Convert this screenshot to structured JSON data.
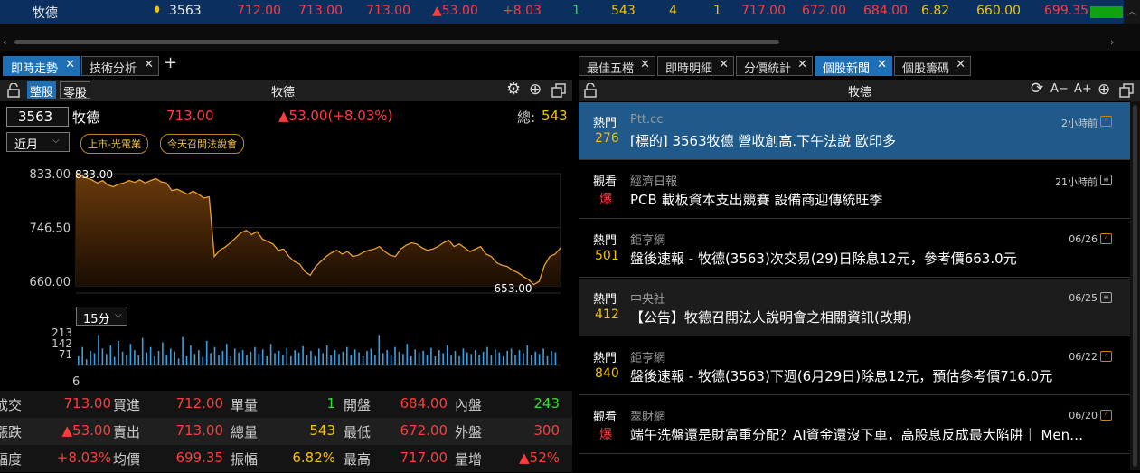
{
  "top_row": {
    "name": "牧德",
    "code": "3563",
    "v1": "712.00",
    "v2": "713.00",
    "v3": "713.00",
    "change": "▲53.00",
    "pct": "+8.03",
    "n1": "1",
    "n2": "543",
    "n3": "4",
    "n4": "1",
    "high": "717.00",
    "low": "672.00",
    "open": "684.00",
    "amp": "6.82",
    "avg": "660.00",
    "prev": "699.35"
  },
  "left_tabs": [
    {
      "label": "即時走勢"
    },
    {
      "label": "技術分析"
    }
  ],
  "add_tab": "+",
  "close_x": "✕",
  "left_panel": {
    "seg_all": "整股",
    "seg_odd": "零股",
    "title": "牧德",
    "code": "3563",
    "name": "牧德",
    "price": "713.00",
    "change": "▲53.00(+8.03%)",
    "total_label": "總:",
    "total": "543",
    "period": "近月",
    "badge1": "上市-光電業",
    "badge2": "今天召開法說會",
    "interval": "15分"
  },
  "chart_data": {
    "type": "area",
    "y_ticks": [
      "833.00",
      "746.50",
      "660.00"
    ],
    "ylim": [
      653,
      833
    ],
    "high_label": "833.00",
    "low_label": "653.00",
    "prices": [
      833,
      830,
      826,
      823,
      818,
      822,
      815,
      812,
      816,
      818,
      822,
      819,
      823,
      818,
      822,
      825,
      820,
      818,
      806,
      808,
      804,
      800,
      805,
      800,
      794,
      796,
      700,
      710,
      715,
      722,
      730,
      738,
      742,
      735,
      740,
      728,
      724,
      720,
      710,
      712,
      700,
      692,
      688,
      676,
      670,
      684,
      692,
      700,
      706,
      710,
      704,
      708,
      700,
      702,
      707,
      710,
      712,
      716,
      708,
      702,
      700,
      712,
      718,
      722,
      720,
      714,
      710,
      712,
      716,
      722,
      726,
      716,
      720,
      714,
      708,
      712,
      716,
      704,
      700,
      690,
      686,
      684,
      678,
      674,
      668,
      663,
      655,
      660,
      686,
      700,
      704,
      714
    ],
    "volume_ticks": [
      "213",
      "142",
      "71"
    ],
    "volume": [
      60,
      120,
      40,
      95,
      80,
      200,
      110,
      75,
      130,
      55,
      160,
      90,
      70,
      140,
      100,
      65,
      180,
      85,
      120,
      60,
      95,
      150,
      70,
      110,
      90,
      45,
      185,
      60,
      130,
      75,
      100,
      55,
      160,
      80,
      120,
      70,
      95,
      140,
      60,
      110,
      85,
      100,
      65,
      90,
      120,
      75,
      105,
      60,
      140,
      80,
      95,
      70,
      115,
      60,
      100,
      85,
      125,
      70,
      95,
      60,
      110,
      80,
      130,
      65,
      100,
      75,
      90,
      120,
      70,
      105,
      85,
      60,
      95,
      110,
      70,
      200,
      80,
      100,
      65,
      120,
      90,
      75,
      140,
      60,
      105,
      85,
      95,
      70,
      115,
      60,
      100,
      80,
      130,
      70,
      95,
      60,
      110,
      85,
      75,
      100,
      65,
      90,
      120,
      70,
      105,
      85,
      60,
      95,
      110,
      70,
      100,
      80,
      130,
      65,
      90,
      75,
      110,
      60,
      95,
      85
    ],
    "x_label": "6"
  },
  "quote_rows": [
    [
      {
        "l": "成交",
        "v": "713.00",
        "c": "red"
      },
      {
        "l": "買進",
        "v": "712.00",
        "c": "red"
      },
      {
        "l": "單量",
        "v": "1",
        "c": "green"
      },
      {
        "l": "開盤",
        "v": "684.00",
        "c": "red"
      },
      {
        "l": "內盤",
        "v": "243",
        "c": "green"
      }
    ],
    [
      {
        "l": "漲跌",
        "v": "▲53.00",
        "c": "red"
      },
      {
        "l": "賣出",
        "v": "713.00",
        "c": "red"
      },
      {
        "l": "總量",
        "v": "543",
        "c": "yellow"
      },
      {
        "l": "最低",
        "v": "672.00",
        "c": "red"
      },
      {
        "l": "外盤",
        "v": "300",
        "c": "red"
      }
    ],
    [
      {
        "l": "幅度",
        "v": "+8.03%",
        "c": "red"
      },
      {
        "l": "均價",
        "v": "699.35",
        "c": "red"
      },
      {
        "l": "振幅",
        "v": "6.82%",
        "c": "yellow"
      },
      {
        "l": "最高",
        "v": "717.00",
        "c": "red"
      },
      {
        "l": "量增",
        "v": "▲52%",
        "c": "red"
      }
    ]
  ],
  "right_tabs": [
    {
      "label": "最佳五檔"
    },
    {
      "label": "即時明細"
    },
    {
      "label": "分價統計"
    },
    {
      "label": "個股新聞"
    },
    {
      "label": "個股籌碼"
    }
  ],
  "right_panel": {
    "title": "牧德",
    "font_minus": "A−",
    "font_plus": "A+"
  },
  "news": [
    {
      "tag": "熱門",
      "count": "276",
      "source": "Ptt.cc",
      "title": "[標的] 3563牧德 營收創高.下午法說 歐印多",
      "time": "2小時前",
      "icon": "rss-icon"
    },
    {
      "tag": "觀看",
      "count": "爆",
      "source": "經濟日報",
      "title": "PCB 載板資本支出競賽 設備商迎傳統旺季",
      "time": "21小時前",
      "icon": "document-icon"
    },
    {
      "tag": "熱門",
      "count": "501",
      "source": "鉅亨網",
      "title": "盤後速報 - 牧德(3563)次交易(29)日除息12元，參考價663.0元",
      "time": "06/26",
      "icon": "rss-icon"
    },
    {
      "tag": "熱門",
      "count": "412",
      "source": "中央社",
      "title": "【公告】牧德召開法人說明會之相關資訊(改期)",
      "time": "06/25",
      "icon": "document-icon"
    },
    {
      "tag": "熱門",
      "count": "840",
      "source": "鉅亨網",
      "title": "盤後速報 - 牧德(3563)下週(6月29日)除息12元，預估參考價716.0元",
      "time": "06/22",
      "icon": "rss-icon"
    },
    {
      "tag": "觀看",
      "count": "爆",
      "source": "翠財網",
      "title": "端午洗盤還是財富重分配？AI資金還沒下車，高股息反成最大陷阱｜ Men…",
      "time": "06/20",
      "icon": "rss-icon"
    }
  ]
}
